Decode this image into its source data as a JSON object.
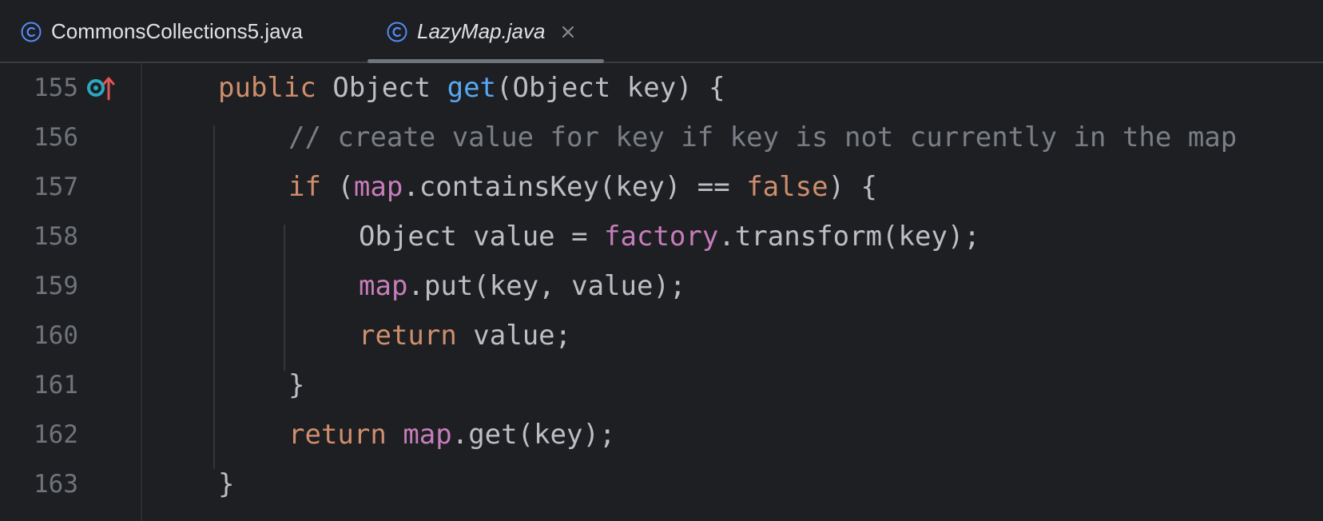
{
  "tabs": [
    {
      "label": "CommonsCollections5.java",
      "active": false,
      "icon": "class-icon"
    },
    {
      "label": "LazyMap.java",
      "active": true,
      "icon": "class-icon",
      "close_icon": "close-icon"
    }
  ],
  "colors": {
    "background": "#1e1f22",
    "keyword": "#cf8e6d",
    "method": "#56a8f5",
    "field": "#c77dbb",
    "comment": "#7a7e85",
    "text": "#bcbec4",
    "line_number": "#6f737a"
  },
  "gutter": {
    "icons": [
      {
        "line": "155",
        "name": "implementing-method-icon"
      }
    ]
  },
  "code_lines": [
    {
      "number": "155",
      "tokens": [
        {
          "t": "public",
          "c": "kw"
        },
        {
          "t": " Object ",
          "c": "txt"
        },
        {
          "t": "get",
          "c": "fn"
        },
        {
          "t": "(Object key) {",
          "c": "txt"
        }
      ]
    },
    {
      "number": "156",
      "tokens": [
        {
          "t": "// create value for key if key is not currently in the map",
          "c": "cmt"
        }
      ]
    },
    {
      "number": "157",
      "tokens": [
        {
          "t": "if",
          "c": "kw"
        },
        {
          "t": " (",
          "c": "txt"
        },
        {
          "t": "map",
          "c": "fld"
        },
        {
          "t": ".containsKey(key) == ",
          "c": "txt"
        },
        {
          "t": "false",
          "c": "kw"
        },
        {
          "t": ") {",
          "c": "txt"
        }
      ]
    },
    {
      "number": "158",
      "tokens": [
        {
          "t": "Object value = ",
          "c": "txt"
        },
        {
          "t": "factory",
          "c": "fld"
        },
        {
          "t": ".transform(key);",
          "c": "txt"
        }
      ]
    },
    {
      "number": "159",
      "tokens": [
        {
          "t": "map",
          "c": "fld"
        },
        {
          "t": ".put(key, value);",
          "c": "txt"
        }
      ]
    },
    {
      "number": "160",
      "tokens": [
        {
          "t": "return",
          "c": "kw"
        },
        {
          "t": " value;",
          "c": "txt"
        }
      ]
    },
    {
      "number": "161",
      "tokens": [
        {
          "t": "}",
          "c": "txt"
        }
      ]
    },
    {
      "number": "162",
      "tokens": [
        {
          "t": "return",
          "c": "kw"
        },
        {
          "t": " ",
          "c": "txt"
        },
        {
          "t": "map",
          "c": "fld"
        },
        {
          "t": ".get(key);",
          "c": "txt"
        }
      ]
    },
    {
      "number": "163",
      "tokens": [
        {
          "t": "}",
          "c": "txt"
        }
      ]
    }
  ]
}
